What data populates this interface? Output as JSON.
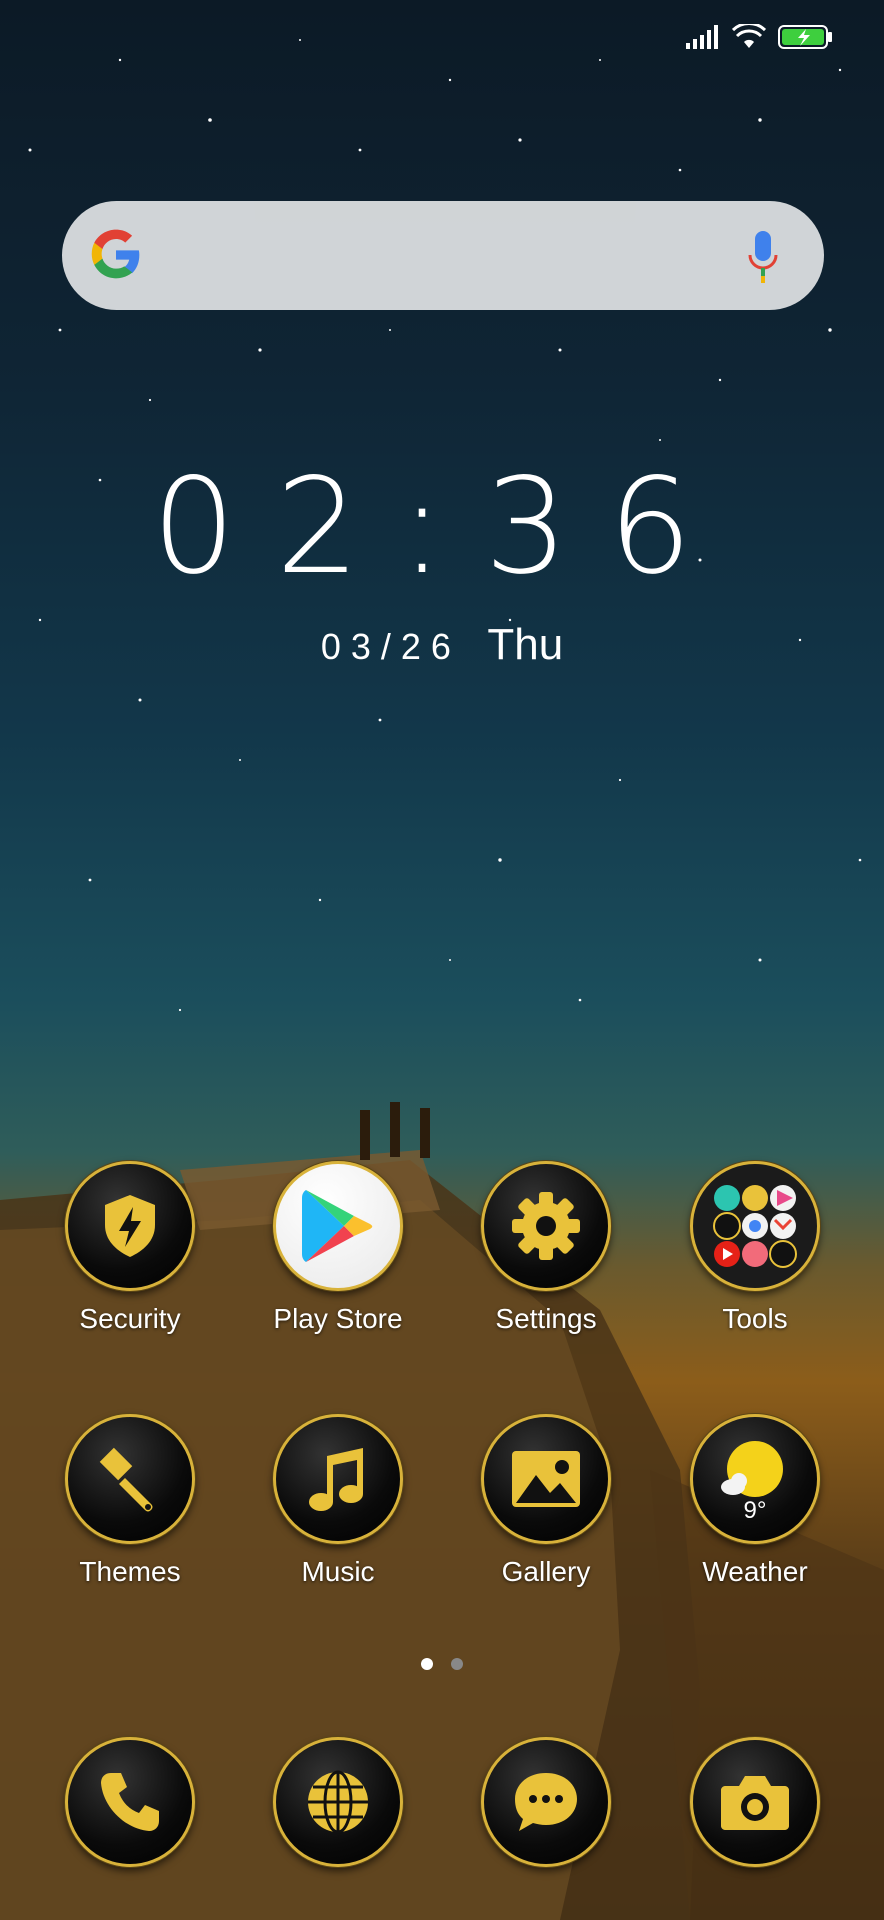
{
  "status": {
    "signal_icon": "signal-icon",
    "wifi_icon": "wifi-icon",
    "battery_icon": "battery-charging-icon"
  },
  "search": {
    "google_icon": "google-logo-icon",
    "mic_icon": "mic-icon"
  },
  "clock": {
    "time": "02:36",
    "date": "03/26",
    "weekday": "Thu"
  },
  "apps": [
    {
      "label": "Security",
      "icon": "shield-icon"
    },
    {
      "label": "Play Store",
      "icon": "play-store-icon"
    },
    {
      "label": "Settings",
      "icon": "gear-icon"
    },
    {
      "label": "Tools",
      "icon": "folder-icon"
    },
    {
      "label": "Themes",
      "icon": "brush-icon"
    },
    {
      "label": "Music",
      "icon": "music-note-icon"
    },
    {
      "label": "Gallery",
      "icon": "image-icon"
    },
    {
      "label": "Weather",
      "icon": "sun-icon",
      "temp": "9°"
    }
  ],
  "dock": [
    {
      "icon": "phone-icon"
    },
    {
      "icon": "globe-icon"
    },
    {
      "icon": "message-icon"
    },
    {
      "icon": "camera-icon"
    }
  ],
  "pages": {
    "count": 2,
    "active": 1
  },
  "colors": {
    "gold": "#e9c23a",
    "ring": "#d8b23a"
  }
}
